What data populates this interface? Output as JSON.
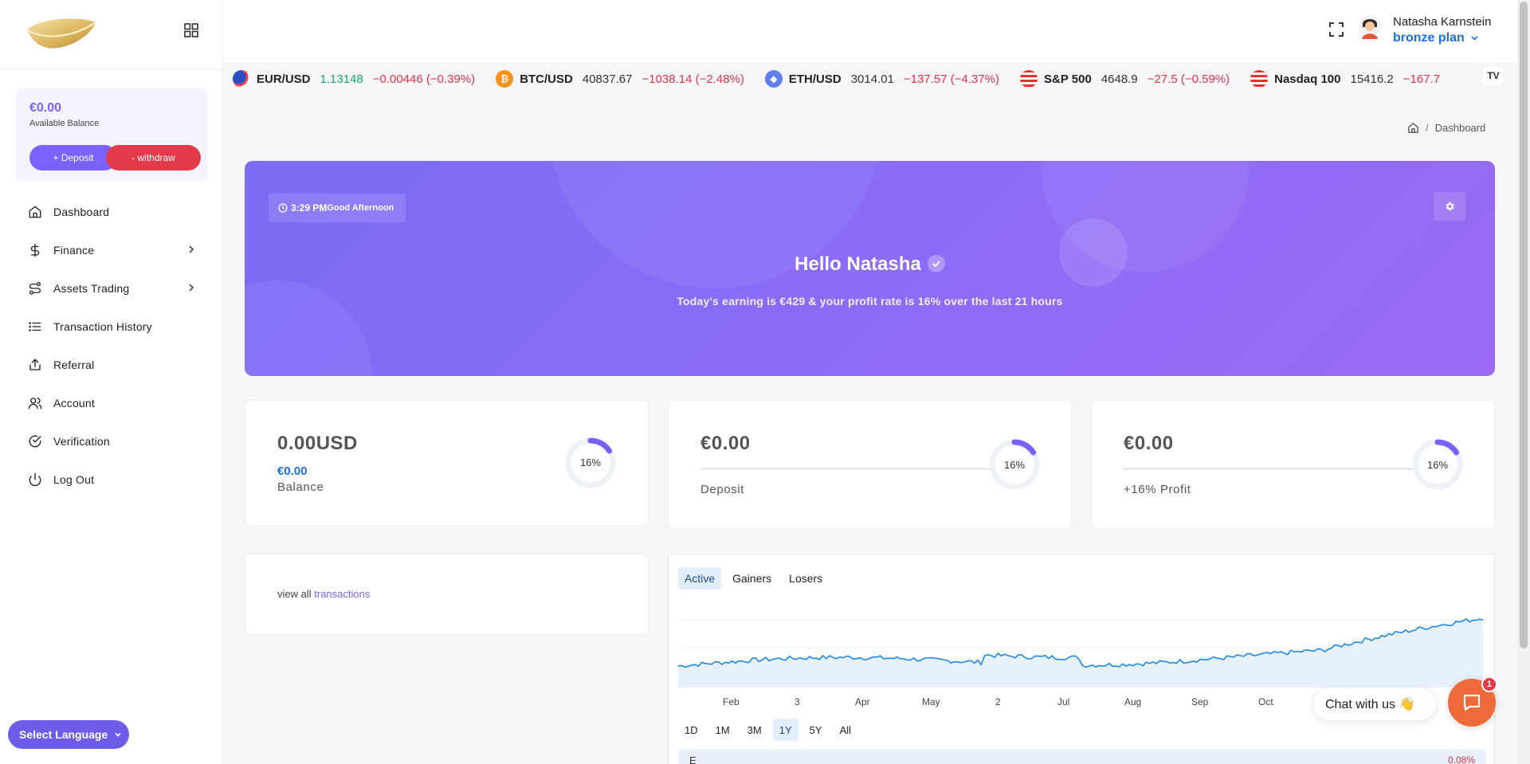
{
  "sidebar": {
    "balance_amount": "€0.00",
    "balance_label": "Available Balance",
    "deposit_label": "+ Deposit",
    "withdraw_label": "- withdraw",
    "items": [
      {
        "label": "Dashboard",
        "icon": "home-icon"
      },
      {
        "label": "Finance",
        "icon": "dollar-icon",
        "has_submenu": true
      },
      {
        "label": "Assets Trading",
        "icon": "route-icon",
        "has_submenu": true
      },
      {
        "label": "Transaction History",
        "icon": "list-icon"
      },
      {
        "label": "Referral",
        "icon": "share-icon"
      },
      {
        "label": "Account",
        "icon": "users-icon"
      },
      {
        "label": "Verification",
        "icon": "check-circle-icon"
      },
      {
        "label": "Log Out",
        "icon": "power-icon"
      }
    ],
    "language_label": "Select Language"
  },
  "header": {
    "user_name": "Natasha Karnstein",
    "plan": "bronze plan"
  },
  "ticker": [
    {
      "symbol": "EUR/USD",
      "price": "1.13148",
      "change": "−0.00446 (−0.39%)",
      "icon": "eu-us-flag-icon"
    },
    {
      "symbol": "BTC/USD",
      "price": "40837.67",
      "change": "−1038.14 (−2.48%)",
      "icon": "bitcoin-icon"
    },
    {
      "symbol": "ETH/USD",
      "price": "3014.01",
      "change": "−137.57 (−4.37%)",
      "icon": "ethereum-icon"
    },
    {
      "symbol": "S&P 500",
      "price": "4648.9",
      "change": "−27.5 (−0.59%)",
      "icon": "us-flag-icon"
    },
    {
      "symbol": "Nasdaq 100",
      "price": "15416.2",
      "change": "−167.7",
      "icon": "us-flag-icon"
    }
  ],
  "breadcrumb": {
    "separator": "/",
    "current": "Dashboard"
  },
  "hero": {
    "time": "3:29 PM",
    "greeting": "Good Afternoon",
    "title": "Hello Natasha",
    "subtitle": "Today's earning is €429 & your profit rate is 16% over the last 21 hours"
  },
  "stats": [
    {
      "title": "0.00USD",
      "sub": "€0.00",
      "label": "Balance",
      "percent": "16%",
      "progress": 0.16
    },
    {
      "title": "€0.00",
      "label": "Deposit",
      "percent": "16%",
      "progress": 0.16
    },
    {
      "title": "€0.00",
      "label": "+16% Profit",
      "percent": "16%",
      "progress": 0.16
    }
  ],
  "transactions_link": {
    "prefix": "view all",
    "link": "transactions"
  },
  "market": {
    "tabs": [
      "Active",
      "Gainers",
      "Losers"
    ],
    "active_tab": "Active",
    "x_labels": [
      "Feb",
      "3",
      "Apr",
      "May",
      "2",
      "Jul",
      "Aug",
      "Sep",
      "Oct"
    ],
    "ranges": [
      "1D",
      "1M",
      "3M",
      "1Y",
      "5Y",
      "All"
    ],
    "active_range": "1Y",
    "bottom_label": "E",
    "bottom_value": "0.08%",
    "line_color": "#1e88e5"
  },
  "chat": {
    "label": "Chat with us 👋",
    "badge": "1"
  },
  "colors": {
    "accent": "#7b61ff",
    "danger": "#e23a4a",
    "link": "#1a6fe8",
    "positive": "#15a66b",
    "negative": "#e5334b"
  }
}
